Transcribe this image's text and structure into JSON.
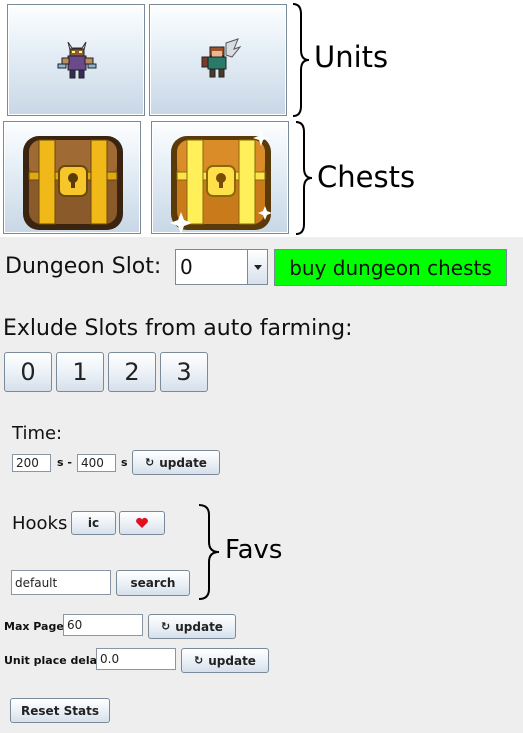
{
  "units": {
    "label": "Units",
    "tiles": [
      {
        "name": "viking-warrior-unit",
        "icon": "horned-warrior-sprite"
      },
      {
        "name": "winged-archer-unit",
        "icon": "winged-archer-sprite"
      }
    ]
  },
  "chests": {
    "label": "Chests",
    "tiles": [
      {
        "name": "bronze-chest",
        "icon": "brown-treasure-chest"
      },
      {
        "name": "gold-chest",
        "icon": "gold-sparkling-treasure-chest"
      }
    ]
  },
  "dungeon": {
    "label": "Dungeon Slot:",
    "selected": "0",
    "buy_label": "buy dungeon chests",
    "buy_color": "#00ff00"
  },
  "exclude": {
    "label": "Exlude Slots from auto farming:",
    "slots": [
      "0",
      "1",
      "2",
      "3"
    ]
  },
  "time": {
    "label": "Time:",
    "min": "200",
    "min_unit": "s -",
    "max": "400",
    "max_unit": "s",
    "update_label": "update"
  },
  "hooks": {
    "label": "Hooks",
    "ic_label": "ic",
    "heart_icon": "heart-icon",
    "heart_color": "#e01020",
    "search_value": "default",
    "search_label": "search"
  },
  "favs": {
    "label": "Favs"
  },
  "max_page": {
    "label": "Max Page",
    "value": "60",
    "update_label": "update"
  },
  "unit_delay": {
    "label": "Unit place delay",
    "value": "0.0",
    "update_label": "update"
  },
  "reset": {
    "label": "Reset Stats"
  }
}
